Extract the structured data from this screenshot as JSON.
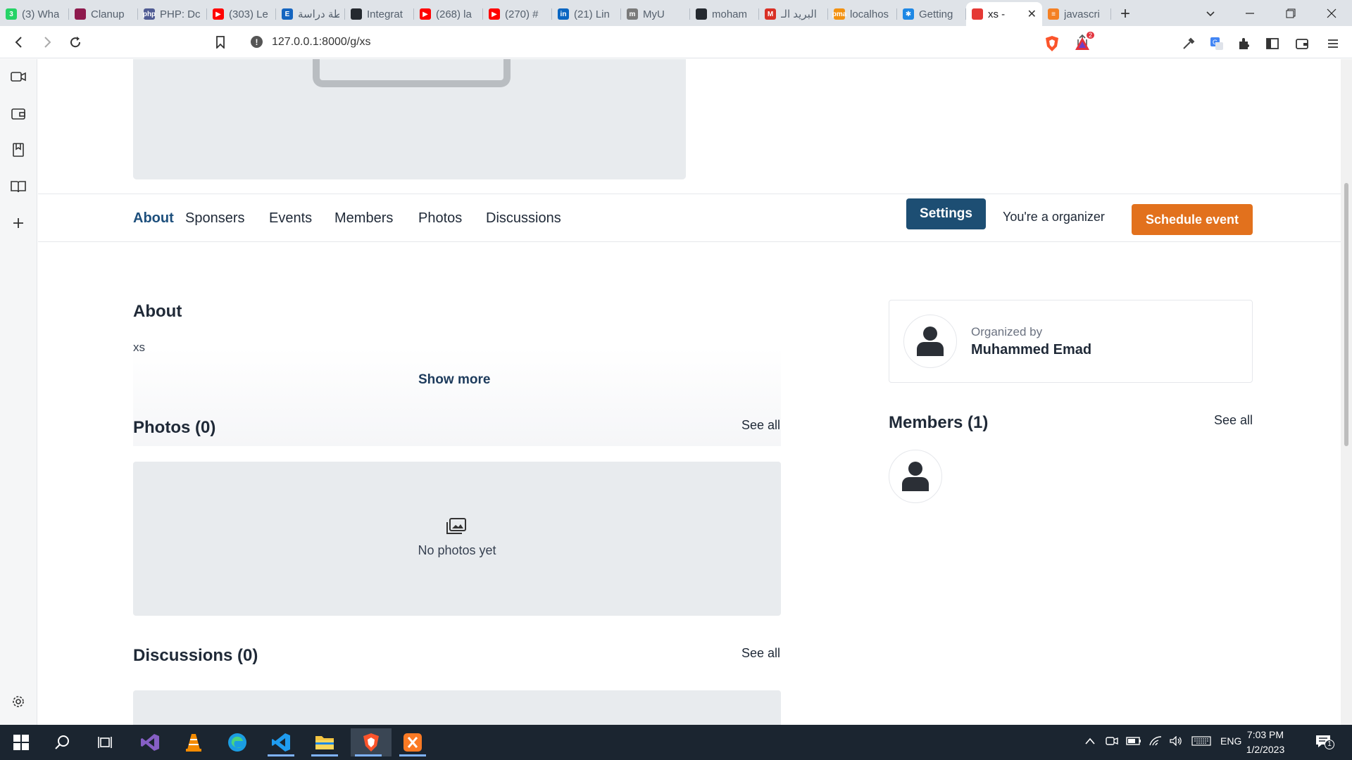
{
  "browser": {
    "tabs": [
      {
        "title": "(3) Wha",
        "favicon": "whatsapp-icon",
        "color": "#25d366",
        "glyph": "3"
      },
      {
        "title": "Clanup",
        "favicon": "clanup-icon",
        "color": "#8e1a4d",
        "glyph": ""
      },
      {
        "title": "PHP: Dc",
        "favicon": "php-icon",
        "color": "#4f5b93",
        "glyph": "php"
      },
      {
        "title": "(303) Le",
        "favicon": "youtube-icon",
        "color": "#ff0000",
        "glyph": "▶"
      },
      {
        "title": "خطة دراسة",
        "favicon": "e-icon",
        "color": "#1565c0",
        "glyph": "E"
      },
      {
        "title": "Integrat",
        "favicon": "github-icon",
        "color": "#24292f",
        "glyph": ""
      },
      {
        "title": "(268) la",
        "favicon": "youtube-icon",
        "color": "#ff0000",
        "glyph": "▶"
      },
      {
        "title": "(270) #",
        "favicon": "youtube-icon",
        "color": "#ff0000",
        "glyph": "▶"
      },
      {
        "title": "(21) Lin",
        "favicon": "linkedin-icon",
        "color": "#0a66c2",
        "glyph": "in"
      },
      {
        "title": "MyU",
        "favicon": "myu-icon",
        "color": "#7a7a7a",
        "glyph": "m"
      },
      {
        "title": "moham",
        "favicon": "github-icon",
        "color": "#24292f",
        "glyph": ""
      },
      {
        "title": "البريد الـ",
        "favicon": "gmail-icon",
        "color": "#d93025",
        "glyph": "M"
      },
      {
        "title": "localhos",
        "favicon": "phpmyadmin-icon",
        "color": "#f29111",
        "glyph": "pma"
      },
      {
        "title": "Getting",
        "favicon": "gear-blue-icon",
        "color": "#1e88e5",
        "glyph": "✱"
      },
      {
        "title": "xs -",
        "favicon": "app-icon",
        "color": "#e53935",
        "glyph": "",
        "active": true
      },
      {
        "title": "javascri",
        "favicon": "stackoverflow-icon",
        "color": "#f48024",
        "glyph": "≡"
      }
    ],
    "url": "127.0.0.1:8000/g/xs",
    "notification_badge": "2"
  },
  "page": {
    "nav": {
      "items": [
        "About",
        "Sponsers",
        "Events",
        "Members",
        "Photos",
        "Discussions"
      ],
      "active": "About"
    },
    "settings_label": "Settings",
    "organizer_text": "You're a organizer",
    "schedule_label": "Schedule event",
    "about": {
      "heading": "About",
      "text": "xs",
      "show_more": "Show more"
    },
    "photos": {
      "heading": "Photos (0)",
      "see_all": "See all",
      "empty": "No photos yet"
    },
    "discussions": {
      "heading": "Discussions (0)",
      "see_all": "See all"
    },
    "organizer_card": {
      "label": "Organized by",
      "name": "Muhammed Emad"
    },
    "members": {
      "heading": "Members (1)",
      "see_all": "See all"
    }
  },
  "taskbar": {
    "language": "ENG",
    "time": "7:03 PM",
    "date": "1/2/2023",
    "notifications": "1"
  }
}
